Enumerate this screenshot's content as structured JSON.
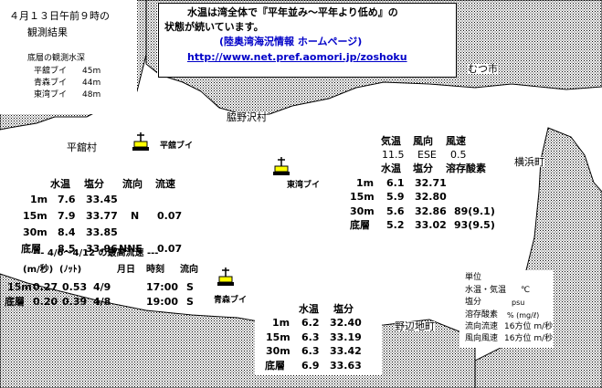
{
  "header": {
    "date": "４月１３日午前９時の",
    "subtitle": "観測結果",
    "depth_title": "底層の観測水深",
    "depths": [
      {
        "name": "平舘ブイ",
        "value": "45m"
      },
      {
        "name": "青森ブイ",
        "value": "44m"
      },
      {
        "name": "東湾ブイ",
        "value": "48m"
      }
    ]
  },
  "banner": {
    "line1": "水温は湾全体で『平年並み～平年より低め』の",
    "line2": "状態が続いています。",
    "line3": "(陸奥湾海況情報 ホームページ)",
    "url": "http://www.net.pref.aomori.jp/zoshoku"
  },
  "places": {
    "mutsu": "むつ市",
    "wakinosawa": "脇野沢村",
    "hiratate": "平舘村",
    "yokohama": "横浜町",
    "noheji": "野辺地町"
  },
  "buoys": {
    "hiratate": "平舘ブイ",
    "tokai": "東湾ブイ",
    "aomori": "青森ブイ"
  },
  "hiratate_table": {
    "headers": [
      "水温",
      "塩分",
      "流向",
      "流速"
    ],
    "rows": [
      {
        "depth": "1m",
        "cells": [
          "7.6",
          "33.45",
          "",
          ""
        ]
      },
      {
        "depth": "15m",
        "cells": [
          "7.9",
          "33.77",
          "N",
          "0.07"
        ]
      },
      {
        "depth": "30m",
        "cells": [
          "8.4",
          "33.85",
          "",
          ""
        ]
      },
      {
        "depth": "底層",
        "cells": [
          "8.5",
          "33.96",
          "NNE",
          "0.07"
        ]
      }
    ]
  },
  "max_flow": {
    "title": "--- 4/6～4/12 の最高流速 ---",
    "headers": [
      "(m/秒)",
      "(ﾉｯﾄ)",
      "月日",
      "時刻",
      "流向"
    ],
    "rows": [
      {
        "depth": "15m",
        "cells": [
          "0.27",
          "0.53",
          "4/9",
          "17:00",
          "S"
        ]
      },
      {
        "depth": "底層",
        "cells": [
          "0.20",
          "0.39",
          "4/8",
          "19:00",
          "S"
        ]
      }
    ]
  },
  "tokai_weather": {
    "headers": [
      "気温",
      "風向",
      "風速"
    ],
    "values": [
      "11.5",
      "ESE",
      "0.5"
    ]
  },
  "tokai_table": {
    "headers": [
      "水温",
      "塩分",
      "溶存酸素"
    ],
    "rows": [
      {
        "depth": "1m",
        "cells": [
          "6.1",
          "32.71",
          ""
        ]
      },
      {
        "depth": "15m",
        "cells": [
          "5.9",
          "32.80",
          ""
        ]
      },
      {
        "depth": "30m",
        "cells": [
          "5.6",
          "32.86",
          "89(9.1)"
        ]
      },
      {
        "depth": "底層",
        "cells": [
          "5.2",
          "33.02",
          "93(9.5)"
        ]
      }
    ]
  },
  "aomori_table": {
    "headers": [
      "水温",
      "塩分"
    ],
    "rows": [
      {
        "depth": "1m",
        "cells": [
          "6.2",
          "32.40"
        ]
      },
      {
        "depth": "15m",
        "cells": [
          "6.3",
          "33.19"
        ]
      },
      {
        "depth": "30m",
        "cells": [
          "6.3",
          "33.42"
        ]
      },
      {
        "depth": "底層",
        "cells": [
          "6.9",
          "33.63"
        ]
      }
    ]
  },
  "legend": {
    "title": "単位",
    "items": [
      {
        "label": "水温・気温",
        "unit": "℃"
      },
      {
        "label": "塩分",
        "unit": "psu"
      },
      {
        "label": "溶存酸素",
        "unit": "%  (mg/ℓ)"
      },
      {
        "label": "流向流速",
        "unit": "16方位  m/秒"
      },
      {
        "label": "風向風速",
        "unit": "16方位  m/秒"
      }
    ]
  },
  "colors": {
    "land_dots": "#000000",
    "link": "#0000c8",
    "background": "#ffffff"
  }
}
